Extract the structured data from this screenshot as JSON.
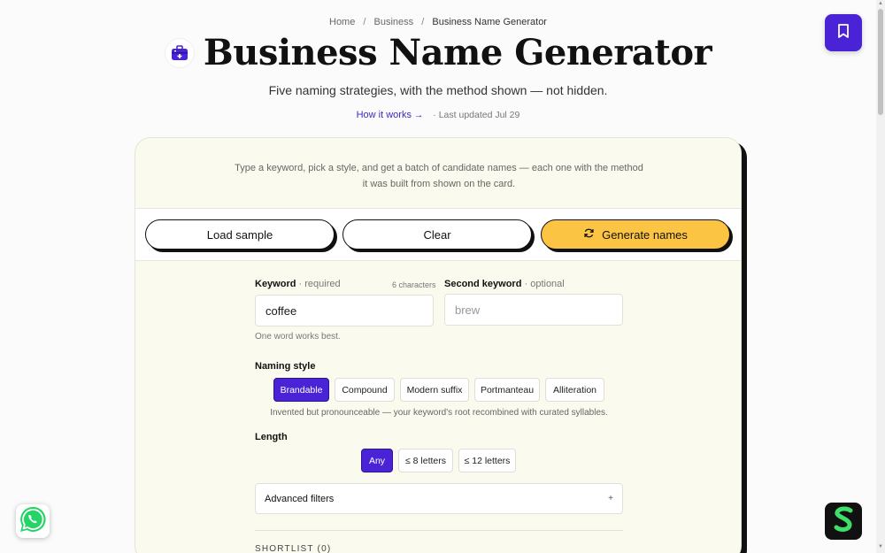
{
  "breadcrumb": {
    "items": [
      "Home",
      "Business",
      "Business Name Generator"
    ],
    "separator": "/"
  },
  "header": {
    "title": "Business Name Generator",
    "subtitle": "Five naming strategies, with the method shown — not hidden.",
    "how_it_works": "How it works",
    "arrow": "→",
    "last_updated": "· Last updated Jul 29"
  },
  "card": {
    "intro": "Type a keyword, pick a style, and get a batch of candidate names — each one with the method it was built from shown on the card.",
    "actions": {
      "load_sample": "Load sample",
      "clear": "Clear",
      "generate": "Generate names"
    },
    "keyword": {
      "label": "Keyword",
      "sub": "· required",
      "char_count": "6 characters",
      "value": "coffee",
      "hint": "One word works best."
    },
    "second_keyword": {
      "label": "Second keyword",
      "sub": "· optional",
      "placeholder": "brew"
    },
    "naming_style": {
      "label": "Naming style",
      "options": [
        "Brandable",
        "Compound",
        "Modern suffix",
        "Portmanteau",
        "Alliteration"
      ],
      "selected": "Brandable",
      "description": "Invented but pronounceable — your keyword's root recombined with curated syllables."
    },
    "length": {
      "label": "Length",
      "options": [
        "Any",
        "≤ 8 letters",
        "≤ 12 letters"
      ],
      "selected": "Any"
    },
    "advanced_filters": {
      "label": "Advanced filters",
      "toggle": "+"
    },
    "shortlist": {
      "label": "SHORTLIST (0)"
    }
  },
  "colors": {
    "accent": "#4a23d6",
    "generate_button": "#fbc543",
    "card_background": "#fbfaee",
    "link": "#3b2bc4"
  },
  "icons": {
    "title_icon": "toolbox-icon",
    "bookmark": "bookmark-icon",
    "refresh": "refresh-icon",
    "whatsapp": "whatsapp-icon",
    "brand_badge": "s-logo-icon"
  }
}
